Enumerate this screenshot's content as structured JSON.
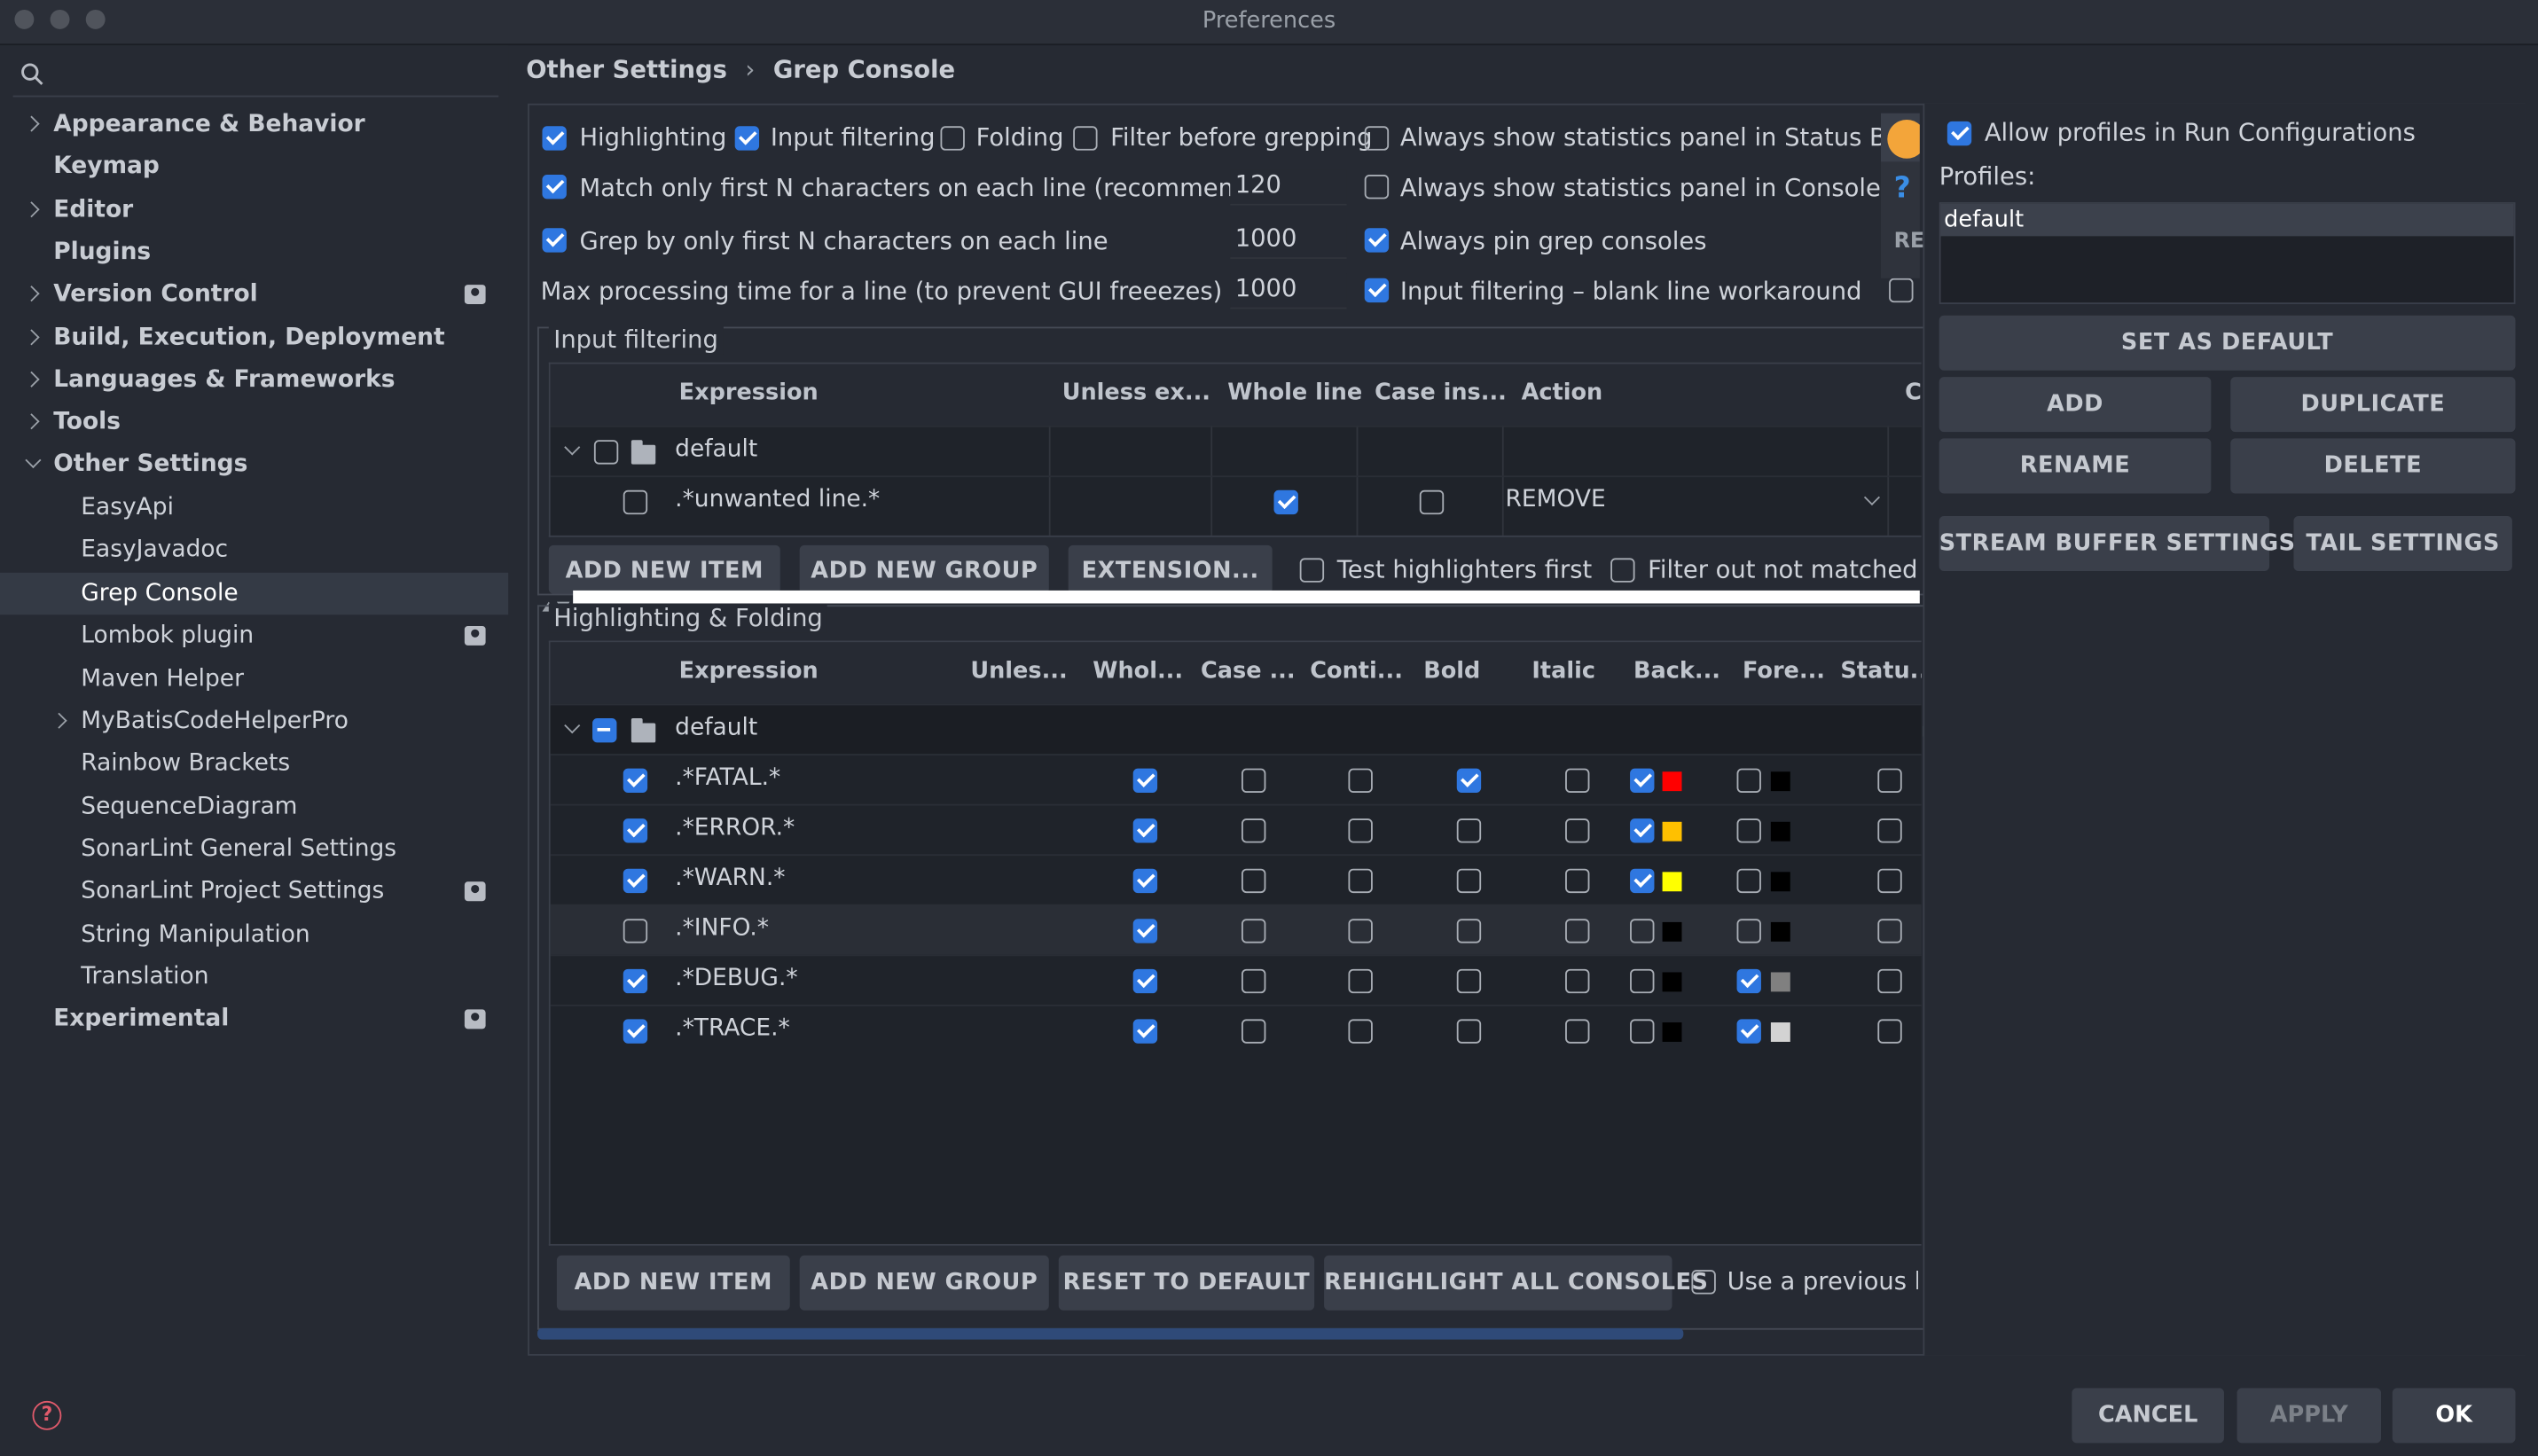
{
  "window": {
    "title": "Preferences"
  },
  "sidebar": {
    "items": [
      {
        "label": "Appearance & Behavior"
      },
      {
        "label": "Keymap"
      },
      {
        "label": "Editor"
      },
      {
        "label": "Plugins"
      },
      {
        "label": "Version Control"
      },
      {
        "label": "Build, Execution, Deployment"
      },
      {
        "label": "Languages & Frameworks"
      },
      {
        "label": "Tools"
      },
      {
        "label": "Other Settings"
      },
      {
        "label": "EasyApi"
      },
      {
        "label": "EasyJavadoc"
      },
      {
        "label": "Grep Console"
      },
      {
        "label": "Lombok plugin"
      },
      {
        "label": "Maven Helper"
      },
      {
        "label": "MyBatisCodeHelperPro"
      },
      {
        "label": "Rainbow Brackets"
      },
      {
        "label": "SequenceDiagram"
      },
      {
        "label": "SonarLint General Settings"
      },
      {
        "label": "SonarLint Project Settings"
      },
      {
        "label": "String Manipulation"
      },
      {
        "label": "Translation"
      },
      {
        "label": "Experimental"
      }
    ]
  },
  "breadcrumb": {
    "parent": "Other Settings",
    "sep": "›",
    "current": "Grep Console"
  },
  "options": {
    "highlighting": "Highlighting",
    "input_filtering": "Input filtering",
    "folding": "Folding",
    "filter_before": "Filter before grepping",
    "stats_status_bar": "Always show statistics panel in Status Bar",
    "match_first_n": "Match only first N characters on each line (recommended)",
    "match_first_n_value": "120",
    "stats_console": "Always show statistics panel in Console",
    "grep_first_n": "Grep by only first N characters on each line",
    "grep_first_n_value": "1000",
    "pin_consoles": "Always pin grep consoles",
    "max_time": "Max processing time for a line (to prevent GUI freeezes) [ms]",
    "max_time_value": "1000",
    "blank_workaround": "Input filtering – blank line workaround",
    "help_glyph": "?",
    "re_text": "RE"
  },
  "input_filtering": {
    "title": "Input filtering",
    "headers": [
      "Expression",
      "Unless ex...",
      "Whole line",
      "Case ins...",
      "Action",
      "C"
    ],
    "group": "default",
    "rows": [
      {
        "expression": ".*unwanted line.*",
        "action": "REMOVE"
      }
    ],
    "buttons": {
      "add_item": "ADD NEW ITEM",
      "add_group": "ADD NEW GROUP",
      "extension": "EXTENSION...",
      "test_first": "Test highlighters first",
      "filter_out": "Filter out not matched li"
    }
  },
  "highlighting": {
    "title": "Highlighting & Folding",
    "headers": [
      "Expression",
      "Unles...",
      "Whol...",
      "Case ...",
      "Conti...",
      "Bold",
      "Italic",
      "Back...",
      "Fore...",
      "Statu..."
    ],
    "group": "default",
    "rows": [
      {
        "expression": ".*FATAL.*",
        "bg": "#ff0000",
        "fg": "#000000"
      },
      {
        "expression": ".*ERROR.*",
        "bg": "#ffc000",
        "fg": "#000000"
      },
      {
        "expression": ".*WARN.*",
        "bg": "#ffff00",
        "fg": "#000000"
      },
      {
        "expression": ".*INFO.*",
        "bg": "#000000",
        "fg": "#000000"
      },
      {
        "expression": ".*DEBUG.*",
        "bg": "#000000",
        "fg": "#808080"
      },
      {
        "expression": ".*TRACE.*",
        "bg": "#000000",
        "fg": "#d3d3d3"
      }
    ],
    "buttons": {
      "add_item": "ADD NEW ITEM",
      "add_group": "ADD NEW GROUP",
      "reset": "RESET TO DEFAULT",
      "rehighlight": "REHIGHLIGHT ALL CONSOLES",
      "use_previous": "Use a previous hi"
    }
  },
  "profiles": {
    "allow_label": "Allow profiles in Run Configurations",
    "label": "Profiles:",
    "items": [
      "default"
    ],
    "set_default": "SET AS DEFAULT",
    "add": "ADD",
    "duplicate": "DUPLICATE",
    "rename": "RENAME",
    "delete": "DELETE",
    "stream_buffer": "STREAM BUFFER SETTINGS",
    "tail": "TAIL SETTINGS"
  },
  "footer": {
    "cancel": "CANCEL",
    "apply": "APPLY",
    "ok": "OK",
    "help": "?"
  },
  "colors": {
    "accent": "#2f77e0",
    "bg": "#262a33"
  }
}
